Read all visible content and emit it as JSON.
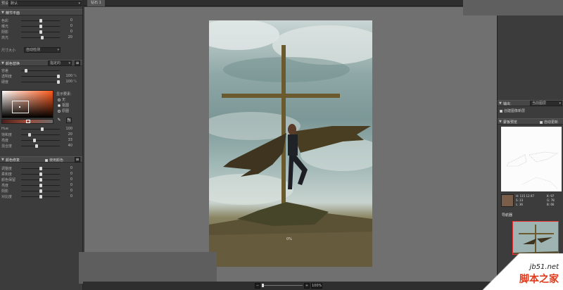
{
  "left_panel": {
    "preset_label": "预设",
    "preset_value": "默认",
    "fine_tune": {
      "title": "精节平面",
      "rows": [
        {
          "label": "色彩",
          "value": "0",
          "pos": 0.5
        },
        {
          "label": "曝光",
          "value": "0",
          "pos": 0.5
        },
        {
          "label": "阴影",
          "value": "0",
          "pos": 0.5
        },
        {
          "label": "高光",
          "value": "20",
          "pos": 0.55
        }
      ],
      "size_label": "尺寸大小",
      "size_value": "自动检测"
    },
    "color_replace": {
      "title": "颜色替换",
      "dropdown": "指定的",
      "rows": [
        {
          "label": "容差",
          "value": "",
          "unit": "",
          "pos": 0.1
        },
        {
          "label": "透明度",
          "value": "100",
          "unit": "%",
          "pos": 1.0
        },
        {
          "label": "硬度",
          "value": "100",
          "unit": "%",
          "pos": 1.0
        }
      ],
      "display_label": "显示要素:",
      "radio_options": [
        "无",
        "抠图",
        "原图"
      ],
      "radio_selected": 1,
      "hsl_rows": [
        {
          "label": "Hue",
          "value": "100",
          "pos": 0.55
        },
        {
          "label": "饱和度",
          "value": "20",
          "pos": 0.2
        },
        {
          "label": "亮度",
          "value": "33",
          "pos": 0.33
        },
        {
          "label": "混合度",
          "value": "40",
          "pos": 0.4
        }
      ]
    },
    "edge_repair": {
      "title": "颜色修复",
      "checkbox_label": "使用颜色",
      "rows": [
        {
          "label": "调整度",
          "value": "0",
          "pos": 0.5
        },
        {
          "label": "柔和度",
          "value": "0",
          "pos": 0.5
        },
        {
          "label": "颜色保留",
          "value": "0",
          "pos": 0.5
        },
        {
          "label": "亮度",
          "value": "0",
          "pos": 0.5
        },
        {
          "label": "阴影",
          "value": "0",
          "pos": 0.5
        },
        {
          "label": "对比度",
          "value": "0",
          "pos": 0.5
        }
      ]
    }
  },
  "workspace": {
    "tab_label": "钻石 1",
    "progress_label": "0%",
    "zoom_value": "100%"
  },
  "right_panel": {
    "output_title": "输出",
    "output_value": "当前图层",
    "create_new_layer": "创建图像新层",
    "preview_title": "蒙板预览",
    "auto_update": "自动更新",
    "info": {
      "h": "H: 115 12.97",
      "s": "S: 23",
      "l": "L: 36",
      "k": "K: 97",
      "g": "G: 78",
      "b": "B: 66"
    },
    "navigator_title": "导航器"
  },
  "watermark": {
    "site": "jb51.net",
    "name": "脚本之家"
  },
  "colors": {
    "accent_red": "#e33333",
    "watermark_red": "#e03a1c"
  }
}
